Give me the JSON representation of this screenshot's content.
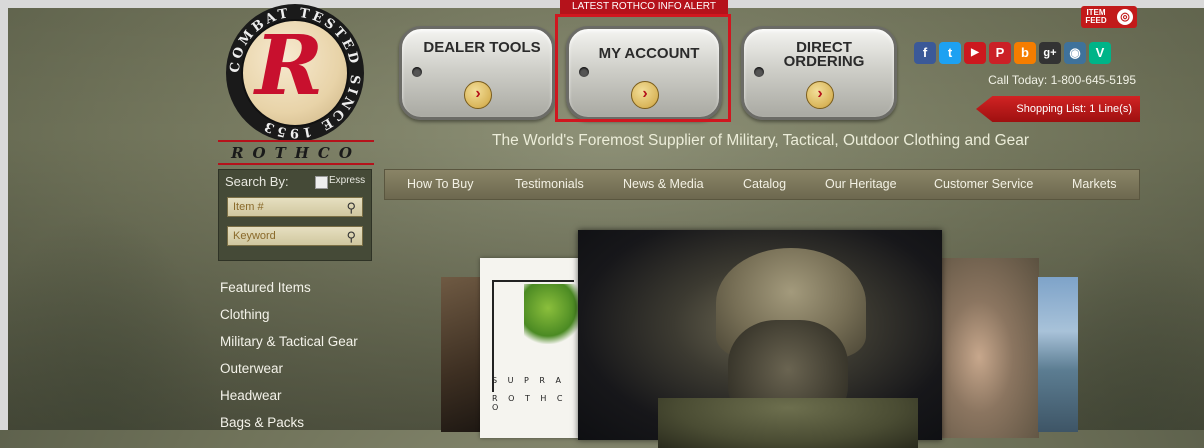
{
  "brand": {
    "name": "ROTHCO",
    "ring_text": "COMBAT TESTED SINCE 1953"
  },
  "alert": {
    "label": "LATEST ROTHCO INFO ALERT"
  },
  "tags": [
    {
      "label": "DEALER TOOLS",
      "arrow": "›"
    },
    {
      "label": "MY ACCOUNT",
      "arrow": "›"
    },
    {
      "label": "DIRECT ORDERING",
      "arrow": "›"
    }
  ],
  "item_feed": {
    "label": "ITEM FEED"
  },
  "social": [
    {
      "icon": "facebook-icon",
      "glyph": "f",
      "color": "#3b5998"
    },
    {
      "icon": "twitter-icon",
      "glyph": "t",
      "color": "#1da1f2"
    },
    {
      "icon": "youtube-icon",
      "glyph": "▶",
      "color": "#cc181e"
    },
    {
      "icon": "pinterest-icon",
      "glyph": "P",
      "color": "#cb2027"
    },
    {
      "icon": "blog-icon",
      "glyph": "b",
      "color": "#f57d00"
    },
    {
      "icon": "google-plus-icon",
      "glyph": "g+",
      "color": "#333333"
    },
    {
      "icon": "instagram-icon",
      "glyph": "◉",
      "color": "#3f729b"
    },
    {
      "icon": "vine-icon",
      "glyph": "V",
      "color": "#00b488"
    }
  ],
  "contact": {
    "call": "Call Today: 1-800-645-5195"
  },
  "shopping_list": {
    "label": "Shopping List: 1 Line(s)"
  },
  "tagline": "The World's Foremost Supplier of Military, Tactical, Outdoor Clothing and Gear",
  "search": {
    "heading": "Search By:",
    "express": "Express",
    "item_placeholder": "Item #",
    "keyword_placeholder": "Keyword"
  },
  "nav": [
    "How To Buy",
    "Testimonials",
    "News & Media",
    "Catalog",
    "Our Heritage",
    "Customer Service",
    "Markets"
  ],
  "menu": [
    "Featured Items",
    "Clothing",
    "Military & Tactical Gear",
    "Outerwear",
    "Headwear",
    "Bags & Packs"
  ],
  "banner": {
    "paper_line1": "S U P R A",
    "paper_line2": "R O T H C O"
  },
  "colors": {
    "accent_red": "#b5121b",
    "highlight_red": "#d0161f"
  }
}
